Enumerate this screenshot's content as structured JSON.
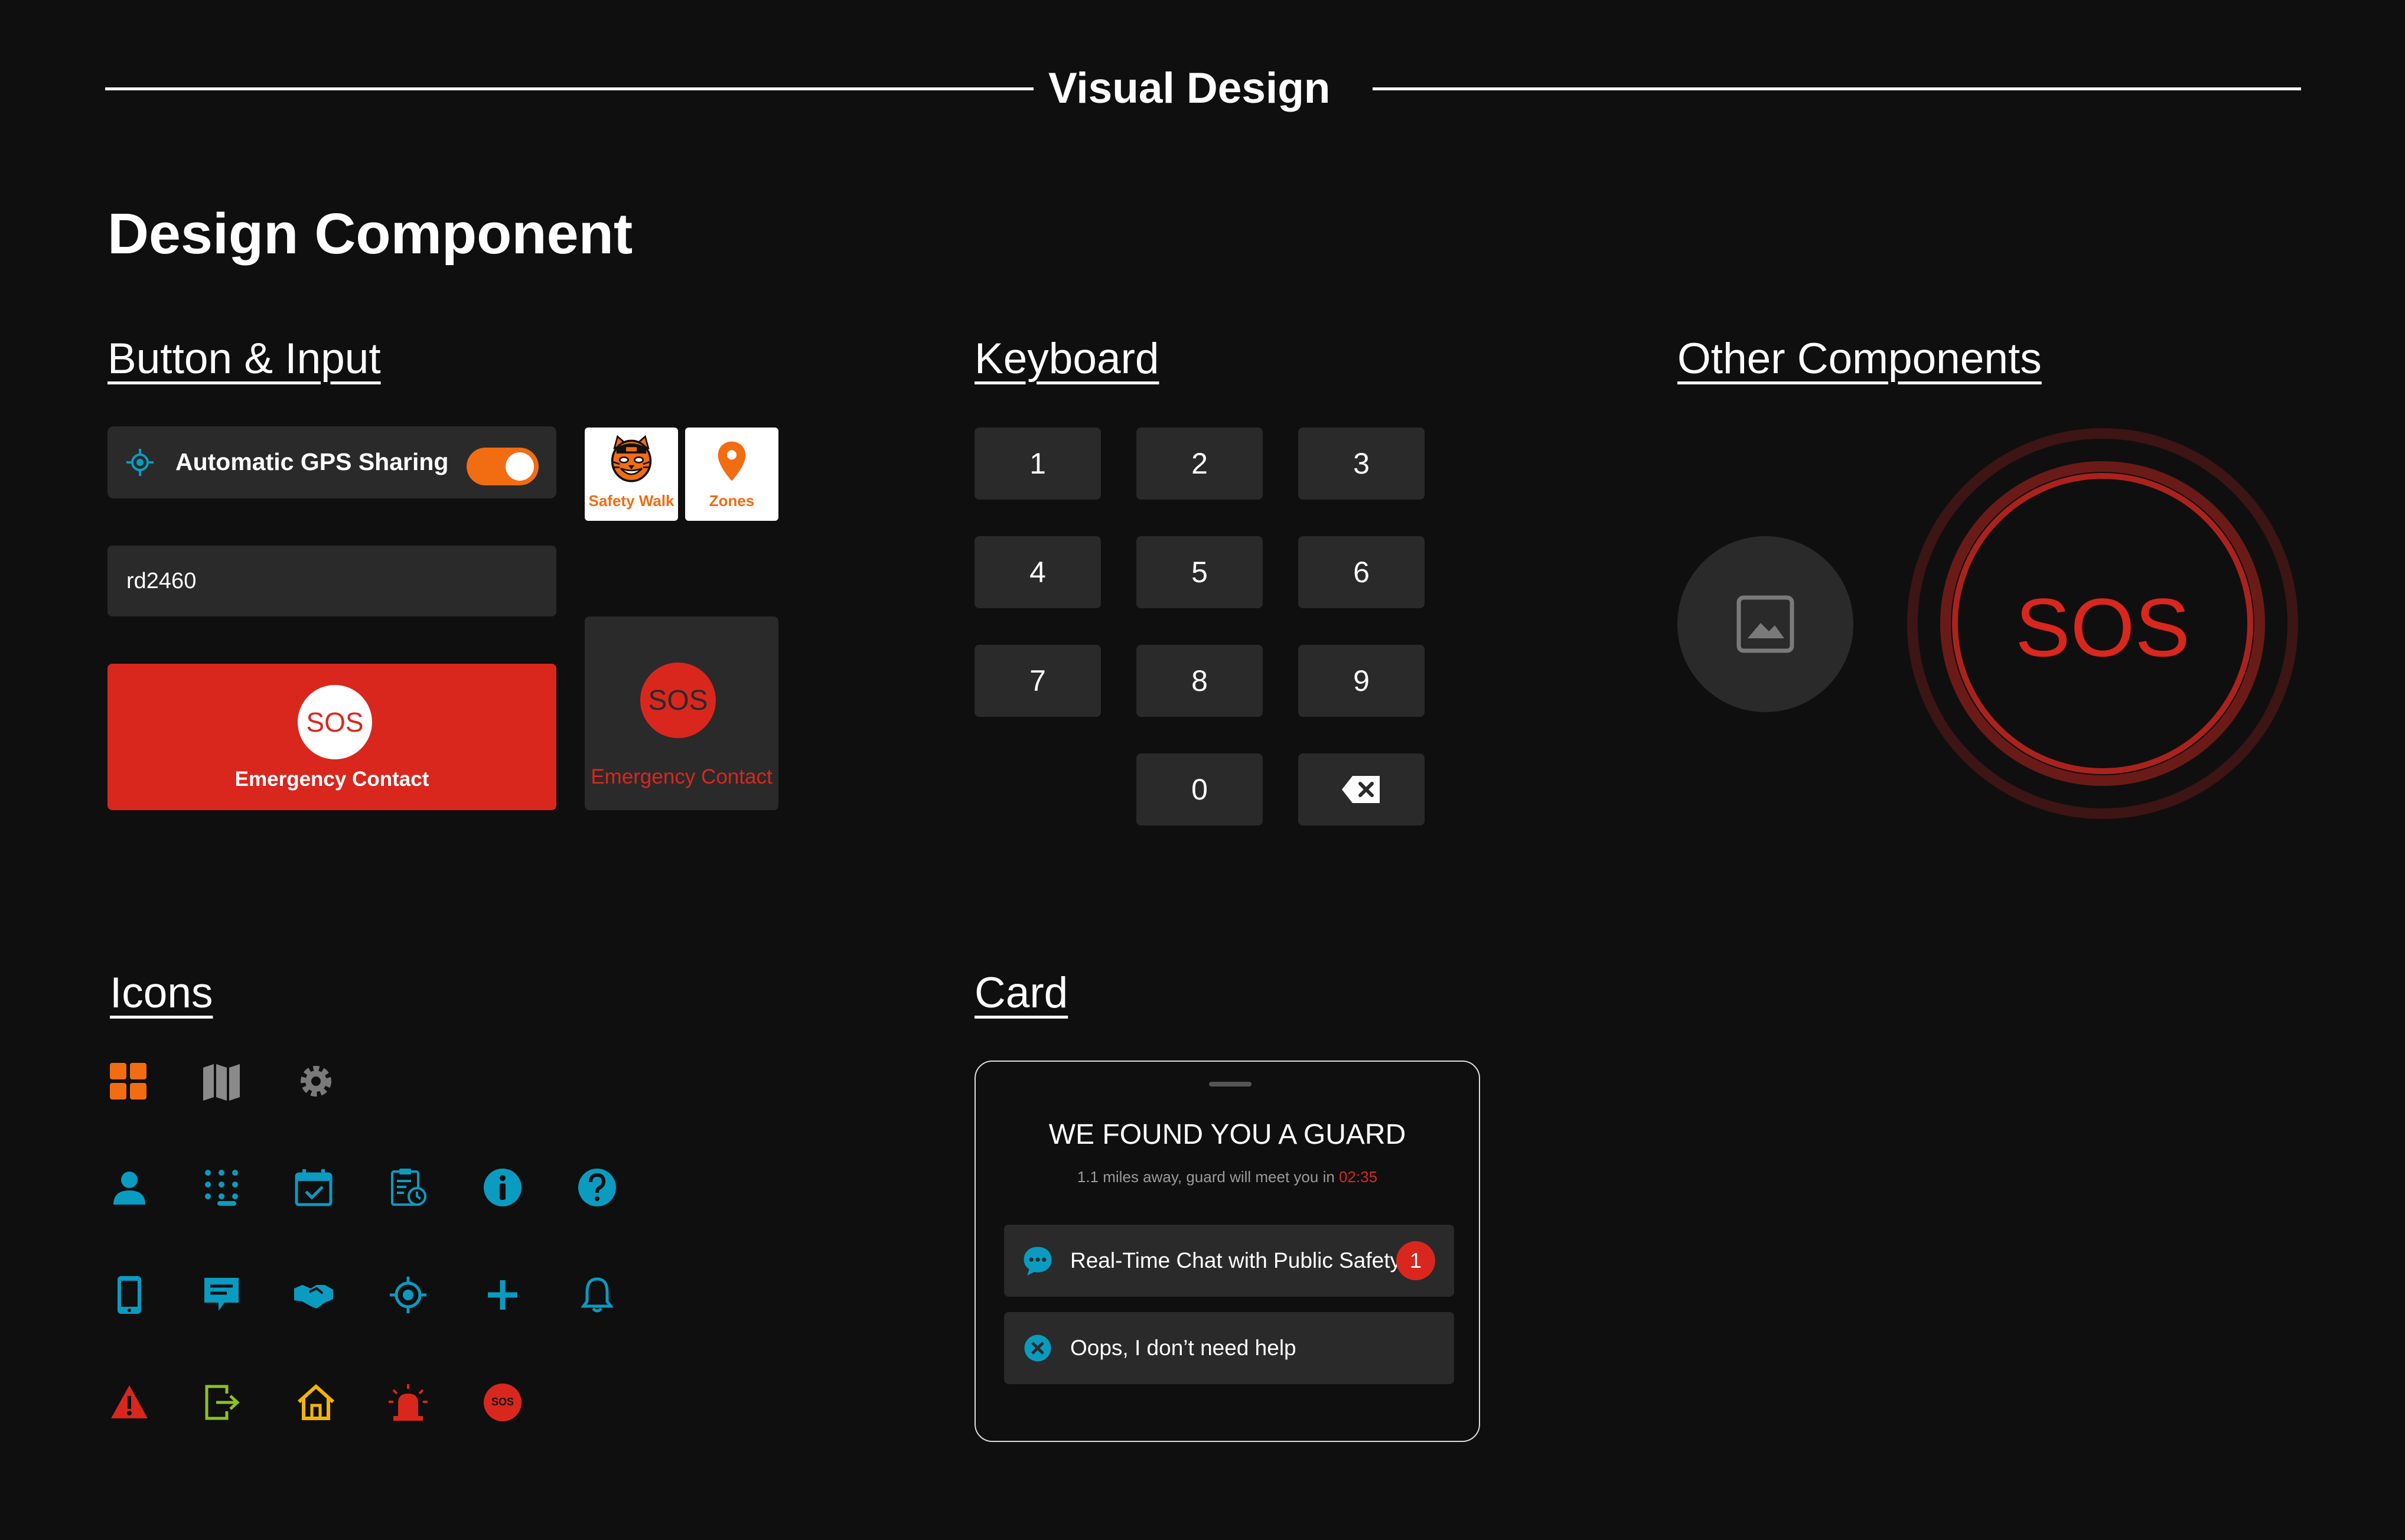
{
  "header": {
    "title": "Visual Design"
  },
  "page": {
    "title": "Design Component"
  },
  "sections": {
    "button_input": "Button & Input",
    "keyboard": "Keyboard",
    "other": "Other Components",
    "icons": "Icons",
    "card": "Card"
  },
  "gps": {
    "label": "Automatic GPS Sharing",
    "enabled": true,
    "icon": "gps-target-icon"
  },
  "tiles": [
    {
      "label": "Safety Walk",
      "icon": "tiger-mascot-icon"
    },
    {
      "label": "Zones",
      "icon": "location-pin-icon"
    }
  ],
  "input": {
    "value": "rd2460"
  },
  "sos_button": {
    "badge": "SOS",
    "label": "Emergency Contact"
  },
  "sos_button_dark": {
    "badge": "SOS",
    "label": "Emergency Contact"
  },
  "keyboard": {
    "keys": [
      "1",
      "2",
      "3",
      "4",
      "5",
      "6",
      "7",
      "8",
      "9",
      "0"
    ],
    "backspace_icon": "backspace-icon"
  },
  "other": {
    "image_placeholder_icon": "image-icon",
    "sos_big": "SOS"
  },
  "icons": {
    "row1": [
      "grid-icon",
      "map-icon",
      "gear-icon"
    ],
    "row2": [
      "user-icon",
      "keypad-icon",
      "calendar-check-icon",
      "clipboard-clock-icon",
      "info-icon",
      "help-icon"
    ],
    "row3": [
      "phone-icon",
      "message-icon",
      "handshake-icon",
      "gps-target-icon",
      "plus-icon",
      "bell-icon"
    ],
    "row4": [
      "warning-icon",
      "exit-icon",
      "home-icon",
      "alarm-icon",
      "sos-icon"
    ],
    "sos_icon_text": "SOS"
  },
  "card": {
    "title": "WE FOUND YOU A GUARD",
    "subtitle_prefix": "1.1 miles away, guard will meet you in",
    "timer": "02:35",
    "chat": {
      "label": "Real-Time Chat with Public Safety",
      "badge": "1",
      "icon": "chat-bubble-icon"
    },
    "cancel": {
      "label": "Oops, I don’t need help",
      "icon": "cancel-circle-icon"
    }
  },
  "colors": {
    "background": "#0f0f0f",
    "surface": "#2a2a2b",
    "accent_orange": "#f26c12",
    "accent_red": "#d9271e",
    "accent_teal": "#0a9bc0",
    "accent_green": "#8dc21f",
    "accent_yellow": "#f4b400"
  }
}
